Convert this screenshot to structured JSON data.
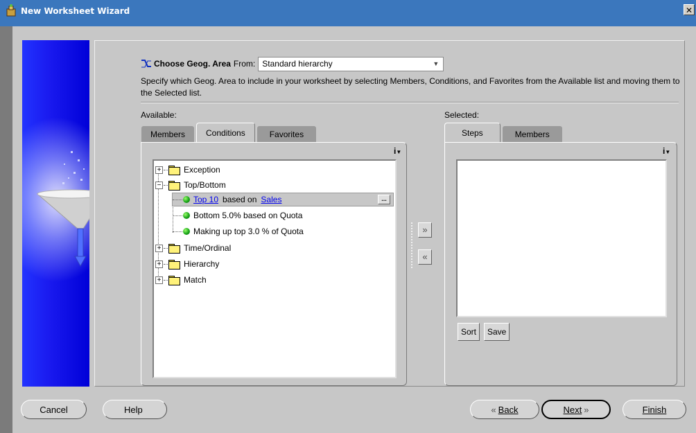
{
  "window": {
    "title": "New Worksheet Wizard",
    "close_label": "✕"
  },
  "header": {
    "choose_label": "Choose Geog. Area",
    "from_label": "From:",
    "hierarchy_value": "Standard hierarchy",
    "description": "Specify which Geog. Area to include in your worksheet by selecting Members, Conditions, and Favorites from the Available list and moving them to the Selected list."
  },
  "available": {
    "label": "Available:",
    "tabs": [
      "Members",
      "Conditions",
      "Favorites"
    ],
    "active_tab": "Conditions",
    "info_label": "i",
    "tree": {
      "exception": "Exception",
      "top_bottom": "Top/Bottom",
      "top_prefix": "Top 10",
      "top_mid": "based on",
      "top_measure": "Sales",
      "more_label": "...",
      "bottom": "Bottom 5.0% based on Quota",
      "making_up": "Making up top 3.0 % of Quota",
      "time_ordinal": "Time/Ordinal",
      "hierarchy": "Hierarchy",
      "match": "Match"
    }
  },
  "move": {
    "add_glyph": "»",
    "remove_glyph": "«"
  },
  "selected": {
    "label": "Selected:",
    "tabs": [
      "Steps",
      "Members"
    ],
    "active_tab": "Steps",
    "info_label": "i",
    "sort_label": "Sort",
    "save_label": "Save"
  },
  "buttons": {
    "cancel": "Cancel",
    "help": "Help",
    "back_glyph": "«",
    "back_label": "Back",
    "next_label": "Next",
    "next_glyph": "»",
    "finish": "Finish"
  },
  "colors": {
    "titlebar": "#3b77bd",
    "banner": "#0000d8",
    "panel": "#c7c7c7",
    "link": "#0000ee"
  }
}
